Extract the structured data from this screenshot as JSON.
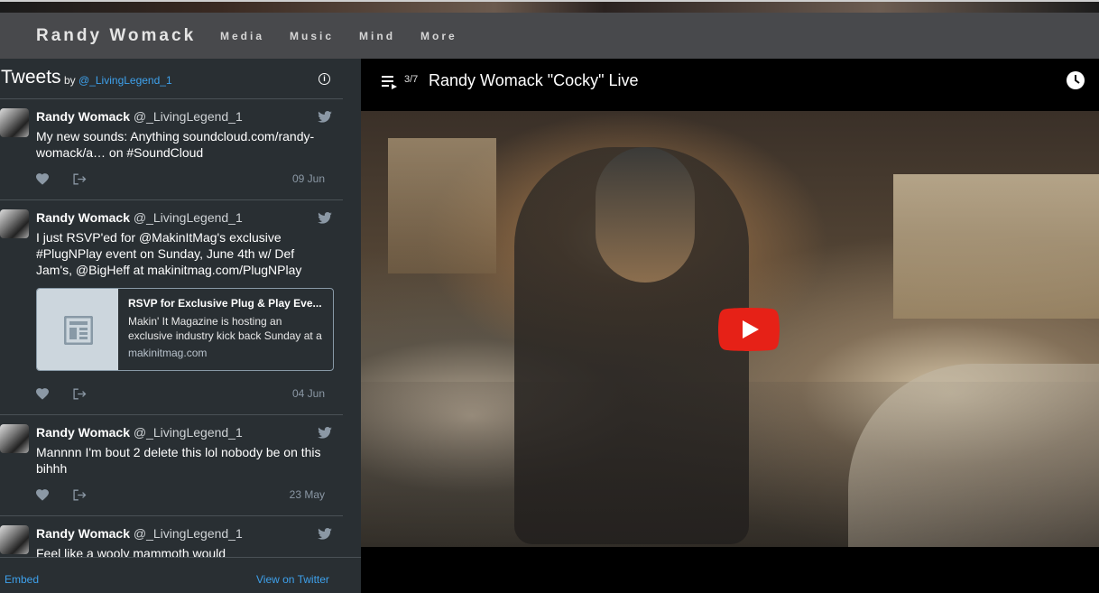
{
  "site": {
    "brand": "Randy Womack",
    "nav": [
      "Media",
      "Music",
      "Mind",
      "More"
    ]
  },
  "twitter": {
    "title": "Tweets",
    "by_label": "by",
    "by_handle": "@_LivingLegend_1",
    "tweets": [
      {
        "author": "Randy Womack",
        "handle": "@_LivingLegend_1",
        "text": "My new sounds: Anything soundcloud.com/randy-womack/a… on #SoundCloud",
        "date": "09 Jun"
      },
      {
        "author": "Randy Womack",
        "handle": "@_LivingLegend_1",
        "text": "I just RSVP'ed for @MakinItMag's exclusive #PlugNPlay event on Sunday, June 4th w/ Def Jam's, @BigHeff at makinitmag.com/PlugNPlay",
        "date": "04 Jun",
        "card": {
          "title": "RSVP for Exclusive Plug & Play Eve...",
          "description": "Makin' It Magazine is hosting an exclusive industry kick back Sunday at a",
          "domain": "makinitmag.com"
        }
      },
      {
        "author": "Randy Womack",
        "handle": "@_LivingLegend_1",
        "text": "Mannnn I'm bout 2 delete this lol nobody be on this bihhh",
        "date": "23 May"
      },
      {
        "author": "Randy Womack",
        "handle": "@_LivingLegend_1",
        "text": "Feel like a wooly mammoth would"
      }
    ],
    "footer": {
      "embed": "Embed",
      "view": "View on Twitter"
    }
  },
  "video": {
    "playlist_position": "3/7",
    "title": "Randy Womack \"Cocky\" Live"
  },
  "colors": {
    "link": "#3ea1ec",
    "youtube_red": "#e62117",
    "panel_bg": "#292f33",
    "nav_bg": "#48494c"
  },
  "icons": [
    "info-icon",
    "twitter-bird-icon",
    "heart-icon",
    "share-icon",
    "article-icon",
    "playlist-icon",
    "clock-icon",
    "play-icon"
  ]
}
